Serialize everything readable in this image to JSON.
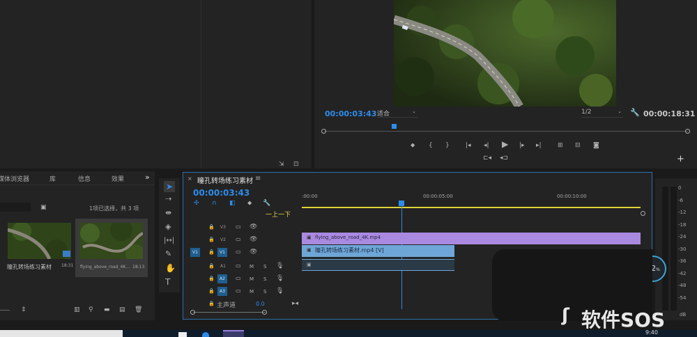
{
  "source_monitor": {},
  "program_monitor": {
    "timecode": "00:00:03:43",
    "fit": "适合",
    "resolution": "1/2",
    "duration": "00:00:18:31",
    "playhead_fraction": 0.2
  },
  "project_panel": {
    "tabs": [
      "媒体浏览器",
      "库",
      "信息",
      "效果"
    ],
    "selection_status": "1项已选择，共 3 项",
    "items": [
      {
        "name": "瞳孔转场练习素材",
        "duration": "18:31"
      },
      {
        "name": "flying_above_road_4K...",
        "duration": "18:13"
      }
    ]
  },
  "tools_panel": {},
  "timeline": {
    "sequence_name": "瞳孔转场练习素材",
    "timecode": "00:00:03:43",
    "ruler_ticks": [
      ":00:00",
      "00:00:05:00",
      "00:00:10:00"
    ],
    "tooltip": "一上一下",
    "video_tracks": [
      "V3",
      "V2",
      "V1"
    ],
    "audio_tracks": [
      "A1",
      "A2",
      "A3"
    ],
    "source_patch_v": "V1",
    "master_label": "主声道",
    "master_value": "0.0",
    "clips": {
      "v2": "flying_above_road_4K.mp4",
      "v1": "瞳孔转场练习素材.mp4 [V]"
    }
  },
  "audio_meter": {
    "labels": [
      "0",
      "-6",
      "-12",
      "-18",
      "-24",
      "-30",
      "-36",
      "-42",
      "-48",
      "-54",
      "dB"
    ]
  },
  "overlay": {
    "percent": "62",
    "percent_sign": "%"
  },
  "watermark": {
    "text": "软件SOS"
  },
  "taskbar": {
    "time": "9:40"
  },
  "colors": {
    "accent": "#2d8ceb",
    "v2_clip": "#a98ae0",
    "v1_clip": "#6fa6d8",
    "playhead": "#2d8ceb",
    "work_area": "#e0d437"
  }
}
